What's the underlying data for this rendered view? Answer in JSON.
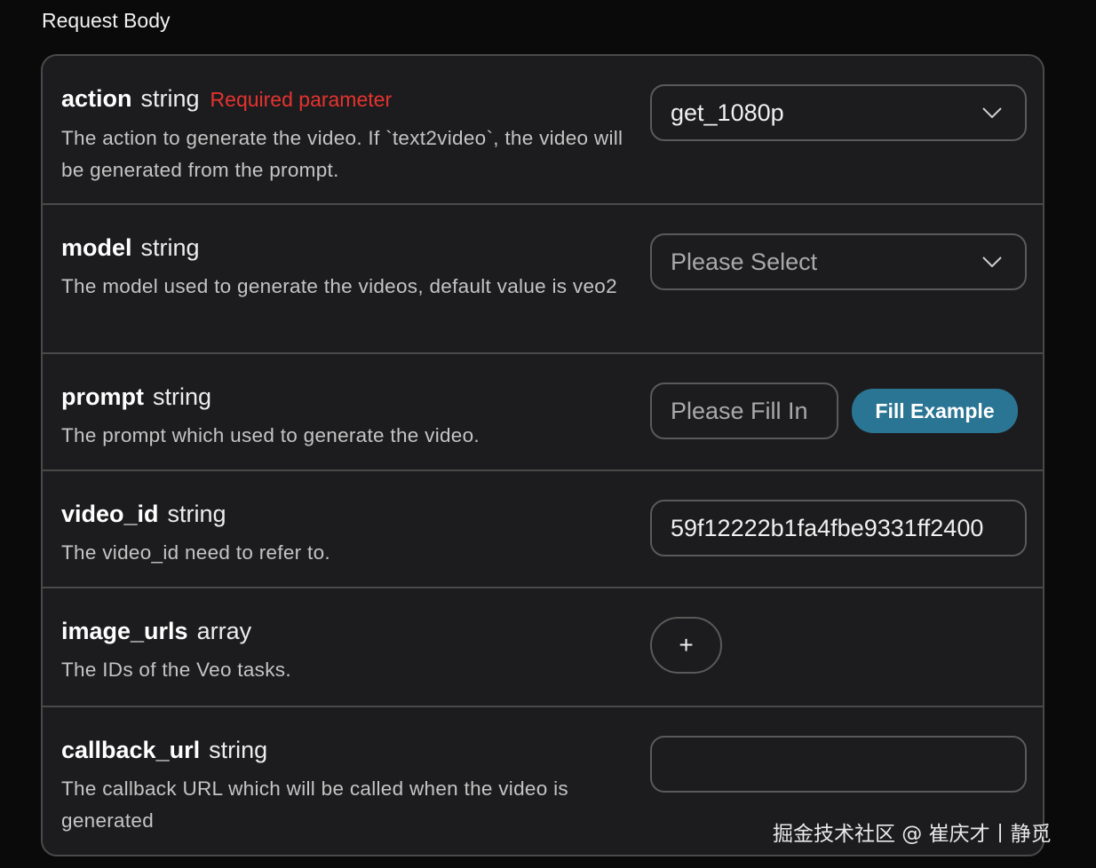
{
  "section_title": "Request Body",
  "params": [
    {
      "name": "action",
      "type": "string",
      "required_label": "Required parameter",
      "description": "The action to generate the video. If `text2video`, the video will be generated from the prompt.",
      "control": {
        "kind": "select",
        "value": "get_1080p"
      }
    },
    {
      "name": "model",
      "type": "string",
      "description": "The model used to generate the videos, default value is veo2",
      "control": {
        "kind": "select",
        "placeholder": "Please Select"
      }
    },
    {
      "name": "prompt",
      "type": "string",
      "description": "The prompt which used to generate the video.",
      "control": {
        "kind": "input",
        "placeholder": "Please Fill In",
        "button_label": "Fill Example"
      }
    },
    {
      "name": "video_id",
      "type": "string",
      "description": "The video_id need to refer to.",
      "control": {
        "kind": "input",
        "value": "59f12222b1fa4fbe9331ff2400"
      }
    },
    {
      "name": "image_urls",
      "type": "array",
      "description": "The IDs of the Veo tasks.",
      "control": {
        "kind": "array-add",
        "button_label": "+"
      }
    },
    {
      "name": "callback_url",
      "type": "string",
      "description": "The callback URL which will be called when the video is generated",
      "control": {
        "kind": "input",
        "value": ""
      }
    }
  ],
  "watermark": "掘金技术社区 @ 崔庆才丨静觅",
  "colors": {
    "background": "#0a0a0a",
    "panel": "#1c1c1e",
    "border": "#4a4a4a",
    "required": "#e5332f",
    "accent_button": "#2b7594"
  },
  "icons": [
    "chevron-down-icon",
    "plus-icon"
  ]
}
